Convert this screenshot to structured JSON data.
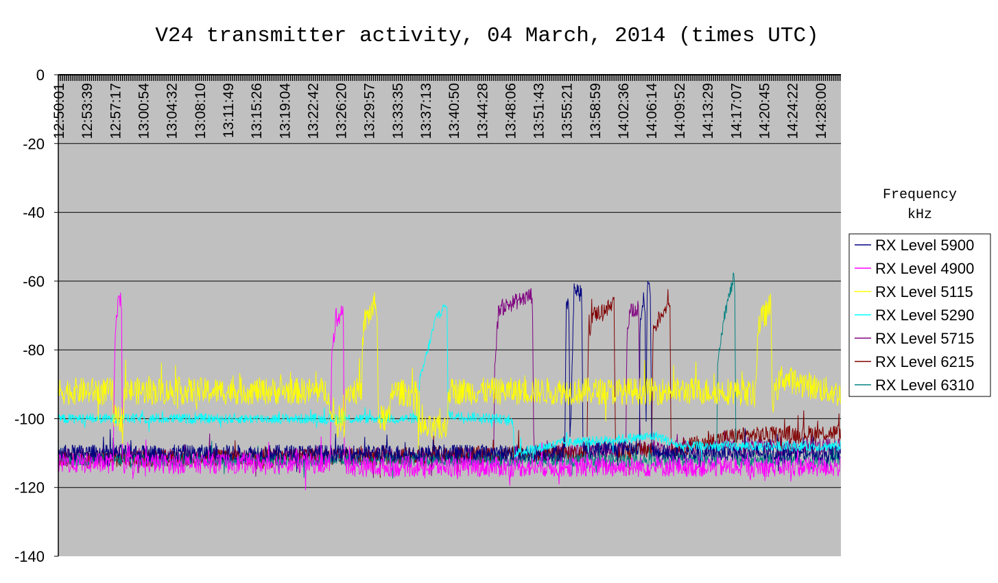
{
  "chart_data": {
    "type": "line",
    "title": "V24 transmitter activity, 04 March, 2014 (times UTC)",
    "xlabel": "",
    "ylabel": "",
    "legend_title": [
      "Frequency",
      "kHz"
    ],
    "legend_position": "right",
    "ylim": [
      -140,
      0
    ],
    "yticks": [
      0,
      -20,
      -40,
      -60,
      -80,
      -100,
      -120,
      -140
    ],
    "y_axis_position": "top",
    "grid": "horizontal",
    "plot_background": "#c0c0c0",
    "xlim": [
      "12:50:01",
      "14:30:40"
    ],
    "x_ticks": [
      "12:50:01",
      "12:53:39",
      "12:57:17",
      "13:00:54",
      "13:04:32",
      "13:08:10",
      "13:11:49",
      "13:15:26",
      "13:19:04",
      "13:22:42",
      "13:26:20",
      "13:29:57",
      "13:33:35",
      "13:37:13",
      "13:40:50",
      "13:44:28",
      "13:48:06",
      "13:51:43",
      "13:55:21",
      "13:58:59",
      "14:02:36",
      "14:06:14",
      "14:09:52",
      "14:13:29",
      "14:17:07",
      "14:20:45",
      "14:24:22",
      "14:28:00"
    ],
    "series": [
      {
        "name": "RX Level 5900",
        "color": "#000080",
        "noise": 2.5,
        "points": [
          [
            "12:50:01",
            -110
          ],
          [
            "13:55:10",
            -110
          ],
          [
            "13:55:20",
            -68
          ],
          [
            "13:55:40",
            -66
          ],
          [
            "13:55:50",
            -108
          ],
          [
            "13:56:20",
            -62
          ],
          [
            "13:57:20",
            -64
          ],
          [
            "13:57:30",
            -109
          ],
          [
            "14:04:45",
            -108
          ],
          [
            "14:04:50",
            -70
          ],
          [
            "14:05:30",
            -67
          ],
          [
            "14:05:35",
            -108
          ],
          [
            "14:05:45",
            -62
          ],
          [
            "14:06:10",
            -62
          ],
          [
            "14:06:20",
            -110
          ],
          [
            "14:30:40",
            -110
          ]
        ]
      },
      {
        "name": "RX Level 4900",
        "color": "#ff00ff",
        "noise": 3,
        "points": [
          [
            "12:50:01",
            -113
          ],
          [
            "12:57:05",
            -113
          ],
          [
            "12:57:15",
            -80
          ],
          [
            "12:57:40",
            -67
          ],
          [
            "12:58:10",
            -66
          ],
          [
            "12:58:15",
            -113
          ],
          [
            "13:25:00",
            -113
          ],
          [
            "13:25:10",
            -83
          ],
          [
            "13:25:40",
            -71
          ],
          [
            "13:26:40",
            -68
          ],
          [
            "13:26:50",
            -114
          ],
          [
            "14:30:40",
            -114
          ]
        ]
      },
      {
        "name": "RX Level 5115",
        "color": "#ffff00",
        "noise": 4,
        "points": [
          [
            "12:50:01",
            -92
          ],
          [
            "12:57:00",
            -92
          ],
          [
            "12:57:10",
            -100
          ],
          [
            "12:58:20",
            -100
          ],
          [
            "12:58:30",
            -92
          ],
          [
            "13:24:50",
            -92
          ],
          [
            "13:25:00",
            -100
          ],
          [
            "13:26:50",
            -100
          ],
          [
            "13:27:00",
            -92
          ],
          [
            "13:29:00",
            -92
          ],
          [
            "13:29:20",
            -72
          ],
          [
            "13:31:00",
            -66
          ],
          [
            "13:31:10",
            -100
          ],
          [
            "13:32:40",
            -100
          ],
          [
            "13:32:50",
            -92
          ],
          [
            "13:36:10",
            -93
          ],
          [
            "13:36:20",
            -103
          ],
          [
            "13:40:00",
            -103
          ],
          [
            "13:40:10",
            -92
          ],
          [
            "14:17:10",
            -92
          ],
          [
            "14:19:40",
            -93
          ],
          [
            "14:20:00",
            -73
          ],
          [
            "14:21:40",
            -67
          ],
          [
            "14:21:50",
            -95
          ],
          [
            "14:23:00",
            -88
          ],
          [
            "14:30:40",
            -93
          ]
        ]
      },
      {
        "name": "RX Level 5290",
        "color": "#00ffff",
        "noise": 1.5,
        "points": [
          [
            "12:50:01",
            -100
          ],
          [
            "13:36:20",
            -100
          ],
          [
            "13:36:30",
            -89
          ],
          [
            "13:38:40",
            -70
          ],
          [
            "13:40:00",
            -67
          ],
          [
            "13:40:10",
            -99
          ],
          [
            "13:46:30",
            -100
          ],
          [
            "13:48:30",
            -101
          ],
          [
            "13:48:40",
            -110
          ],
          [
            "13:55:00",
            -107
          ],
          [
            "14:02:00",
            -106
          ],
          [
            "14:07:00",
            -105
          ],
          [
            "14:10:00",
            -108
          ],
          [
            "14:30:40",
            -108
          ]
        ]
      },
      {
        "name": "RX Level 5715",
        "color": "#800080",
        "noise": 2.5,
        "points": [
          [
            "12:50:01",
            -111
          ],
          [
            "13:46:00",
            -111
          ],
          [
            "13:46:10",
            -83
          ],
          [
            "13:46:40",
            -68
          ],
          [
            "13:51:00",
            -64
          ],
          [
            "13:51:10",
            -110
          ],
          [
            "14:03:00",
            -109
          ],
          [
            "14:03:10",
            -73
          ],
          [
            "14:03:40",
            -68
          ],
          [
            "14:04:40",
            -68
          ],
          [
            "14:04:50",
            -109
          ],
          [
            "14:30:40",
            -108
          ]
        ]
      },
      {
        "name": "RX Level 6215",
        "color": "#800000",
        "noise": 2.5,
        "points": [
          [
            "12:50:01",
            -112
          ],
          [
            "13:58:00",
            -110
          ],
          [
            "13:58:10",
            -78
          ],
          [
            "13:58:40",
            -70
          ],
          [
            "14:01:30",
            -67
          ],
          [
            "14:01:40",
            -110
          ],
          [
            "14:06:20",
            -109
          ],
          [
            "14:06:30",
            -74
          ],
          [
            "14:08:00",
            -68
          ],
          [
            "14:08:40",
            -65
          ],
          [
            "14:08:50",
            -109
          ],
          [
            "14:17:00",
            -105
          ],
          [
            "14:30:40",
            -104
          ]
        ]
      },
      {
        "name": "RX Level 6310",
        "color": "#008080",
        "noise": 2,
        "points": [
          [
            "12:50:01",
            -112
          ],
          [
            "14:14:40",
            -112
          ],
          [
            "14:14:50",
            -82
          ],
          [
            "14:15:40",
            -70
          ],
          [
            "14:17:00",
            -58
          ],
          [
            "14:17:10",
            -112
          ],
          [
            "14:30:40",
            -112
          ]
        ]
      }
    ]
  }
}
